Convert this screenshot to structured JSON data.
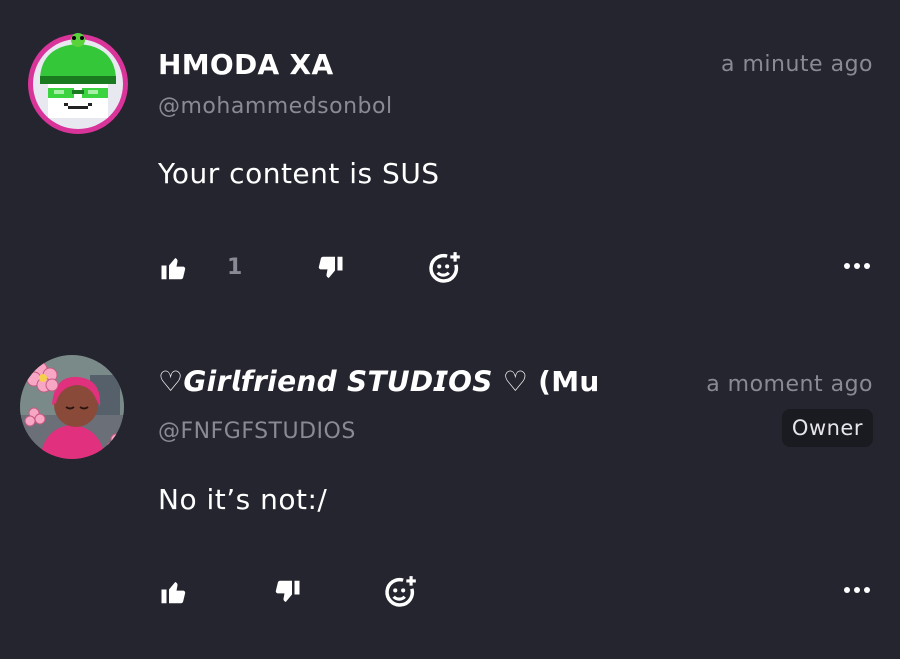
{
  "comments": [
    {
      "author": "HMODA XA",
      "handle": "@mohammedsonbol",
      "time": "a minute ago",
      "text": "Your content is SUS",
      "likes": "1",
      "avatar_icon": "pixel-green-cap-sunglasses-avatar"
    },
    {
      "author": "♡𝙂𝙞𝙧𝙡𝙛𝙧𝙞𝙚𝙣𝙙 𝙎𝙏𝙐𝘿𝙄𝙊𝙎 ♡ (Mu",
      "handle": "@FNFGFSTUDIOS",
      "time": "a moment ago",
      "badge": "Owner",
      "text": "No it’s not:/",
      "avatar_icon": "girl-pink-hood-flowers-avatar"
    }
  ],
  "icons": {
    "like": "thumbs-up-icon",
    "dislike": "thumbs-down-icon",
    "react": "add-reaction-icon",
    "more": "more-options-icon"
  },
  "colors": {
    "background": "#25252f",
    "muted_text": "#8a8a96",
    "badge_bg": "#1a1a21"
  }
}
